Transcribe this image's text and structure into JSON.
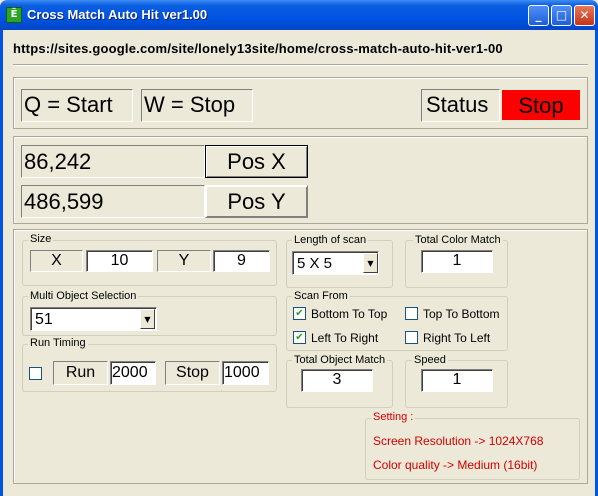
{
  "window": {
    "title": "Cross Match Auto Hit ver1.00",
    "app_icon": "Ë",
    "minimize": "_",
    "maximize": "□",
    "close": "✕"
  },
  "url": "https://sites.google.com/site/lonely13site/home/cross-match-auto-hit-ver1-00",
  "hotkeys": {
    "start": "Q = Start",
    "stop": "W = Stop"
  },
  "status": {
    "label": "Status",
    "value": "Stop",
    "value_color": "#ff0000"
  },
  "position": {
    "x_value": "86,242",
    "x_button": "Pos X",
    "y_value": "486,599",
    "y_button": "Pos Y"
  },
  "size": {
    "label": "Size",
    "x_label": "X",
    "x_value": "10",
    "y_label": "Y",
    "y_value": "9"
  },
  "length_of_scan": {
    "label": "Length of scan",
    "value": "5 X 5"
  },
  "total_color_match": {
    "label": "Total Color Match",
    "value": "1"
  },
  "multi_object": {
    "label": "Multi Object Selection",
    "value": "51"
  },
  "scan_from": {
    "label": "Scan From",
    "bottom_to_top": {
      "label": "Bottom To Top",
      "checked": true
    },
    "top_to_bottom": {
      "label": "Top To Bottom",
      "checked": false
    },
    "left_to_right": {
      "label": "Left To Right",
      "checked": true
    },
    "right_to_left": {
      "label": "Right To Left",
      "checked": false
    }
  },
  "run_timing": {
    "label": "Run Timing",
    "run_label": "Run",
    "run_value": "2000",
    "stop_label": "Stop",
    "stop_value": "1000",
    "checked": false
  },
  "total_object_match": {
    "label": "Total Object Match",
    "value": "3"
  },
  "speed": {
    "label": "Speed",
    "value": "1"
  },
  "setting": {
    "label": "Setting :",
    "resolution": "Screen Resolution -> 1024X768",
    "color_quality": "Color quality -> Medium (16bit)"
  },
  "icons": {
    "dropdown": "▼",
    "check": "✔"
  }
}
